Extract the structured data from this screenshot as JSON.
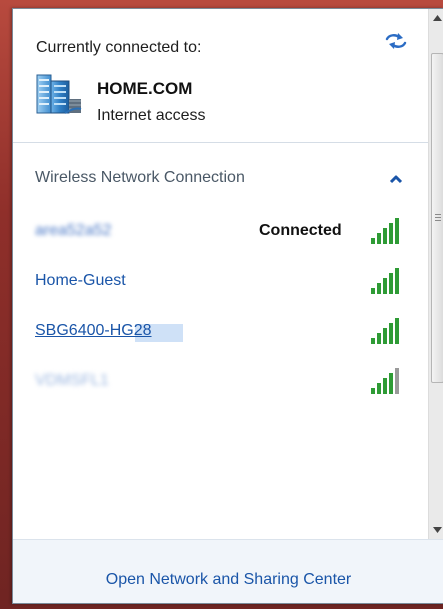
{
  "header": {
    "title": "Currently connected to:",
    "refresh_icon": "refresh-icon"
  },
  "current_network": {
    "name": "HOME.COM",
    "access": "Internet access",
    "icon": "network-icon"
  },
  "section": {
    "title": "Wireless Network Connection",
    "collapse_icon": "chevron-up-icon"
  },
  "networks": [
    {
      "ssid": "area52a52",
      "status": "Connected",
      "signal_bars": 5,
      "obscured": true
    },
    {
      "ssid": "Home-Guest",
      "status": "",
      "signal_bars": 5,
      "obscured": false
    },
    {
      "ssid": "SBG6400-HG28",
      "status": "",
      "signal_bars": 5,
      "obscured": "partial"
    },
    {
      "ssid": "VDMSFL1",
      "status": "",
      "signal_bars": 4,
      "obscured": true
    }
  ],
  "footer": {
    "link": "Open Network and Sharing Center"
  },
  "colors": {
    "link": "#1a55a8",
    "signal_green": "#2e9b35",
    "signal_gray": "#8c8c8c",
    "footer_bg": "#f1f5fa"
  }
}
